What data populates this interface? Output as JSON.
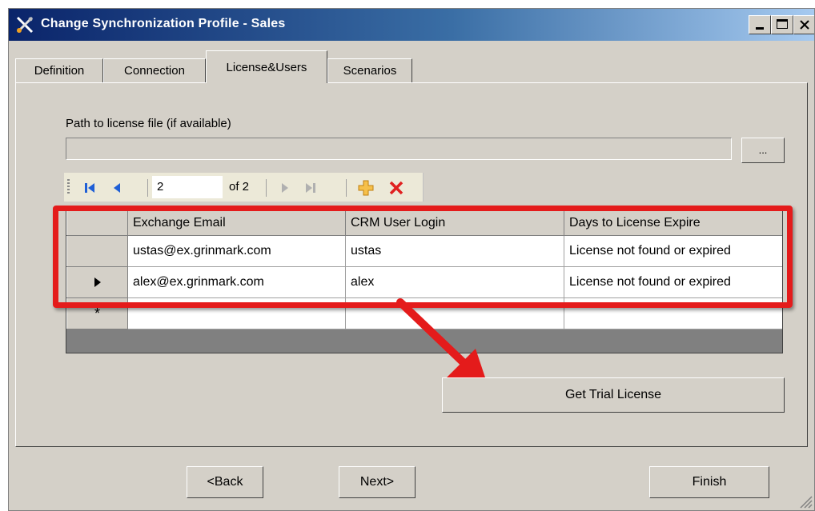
{
  "window": {
    "title": "Change Synchronization Profile - Sales",
    "controls": [
      "minimize-icon",
      "maximize-icon",
      "close-icon"
    ]
  },
  "tabs": [
    {
      "label": "Definition",
      "active": false
    },
    {
      "label": "Connection",
      "active": false
    },
    {
      "label": "License&Users",
      "active": true
    },
    {
      "label": "Scenarios",
      "active": false
    }
  ],
  "license": {
    "path_label": "Path to license file (if available)",
    "path_value": "",
    "browse_label": "..."
  },
  "navigator": {
    "position": "2",
    "of_text": "of 2",
    "icons": [
      "first-record-icon",
      "previous-record-icon",
      "next-record-icon",
      "last-record-icon",
      "add-record-icon",
      "delete-record-icon"
    ]
  },
  "grid": {
    "columns": [
      "Exchange Email",
      "CRM User Login",
      "Days to License Expire"
    ],
    "rows": [
      {
        "email": "ustas@ex.grinmark.com",
        "login": "ustas",
        "days": "License not found or expired",
        "current": false
      },
      {
        "email": "alex@ex.grinmark.com",
        "login": "alex",
        "days": "License not found or expired",
        "current": true
      }
    ],
    "new_row_marker": "*"
  },
  "buttons": {
    "trial": "Get Trial License",
    "back": "<Back",
    "next": "Next>",
    "finish": "Finish"
  },
  "colors": {
    "title_bar": "#0a246a",
    "face": "#d4d0c8",
    "highlight": "#e41b1b"
  }
}
